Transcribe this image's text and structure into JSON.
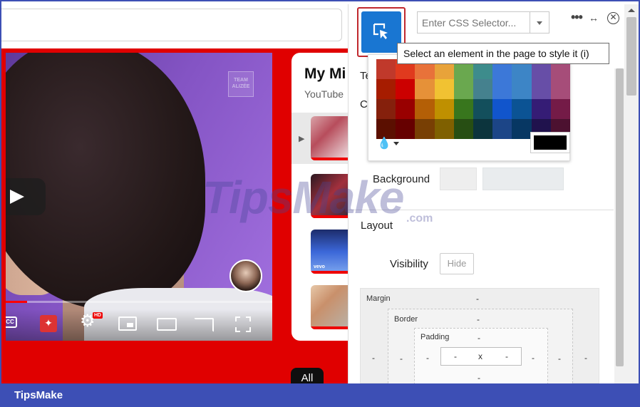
{
  "panel": {
    "selector_placeholder": "Enter CSS Selector...",
    "more_label": "•••",
    "resize_label": "↔",
    "close_label": "✕",
    "tooltip": "Select an element in the page to style it (i)",
    "peek_top": "Te",
    "peek_color": "C",
    "background_label": "Background",
    "layout_title": "Layout",
    "visibility_label": "Visibility",
    "hide_label": "Hide",
    "current_color": "#000000",
    "swatch_colors": [
      "#c0392b",
      "#e03a1e",
      "#e8723a",
      "#e8a33a",
      "#6aa84f",
      "#3d8c8c",
      "#3c78d8",
      "#3d85c6",
      "#674ea7",
      "#a64d79",
      "#a61c00",
      "#cc0000",
      "#e69138",
      "#f1c232",
      "#6aa84f",
      "#45818e",
      "#3c78d8",
      "#3d85c6",
      "#674ea7",
      "#a64d79",
      "#85200c",
      "#990000",
      "#b45f06",
      "#bf9000",
      "#38761d",
      "#134f5c",
      "#1155cc",
      "#0b5394",
      "#351c75",
      "#741b47",
      "#5b0f00",
      "#660000",
      "#783f04",
      "#7f6000",
      "#274e13",
      "#0c343d",
      "#1c4587",
      "#073763",
      "#20124d",
      "#4c1130"
    ],
    "box": {
      "margin_label": "Margin",
      "border_label": "Border",
      "padding_label": "Padding",
      "dash": "-",
      "content": "x"
    }
  },
  "page": {
    "playlist_title": "My Mi",
    "playlist_sub": "YouTube",
    "channel_logo": "TEAM ALIZÉE",
    "hd_badge": "HD",
    "cc_label": "CC",
    "vevo": "vevo",
    "chip_all": "All"
  },
  "watermark": {
    "main": "TipsMake",
    "suffix": ".com"
  },
  "footer": {
    "brand": "TipsMake"
  }
}
